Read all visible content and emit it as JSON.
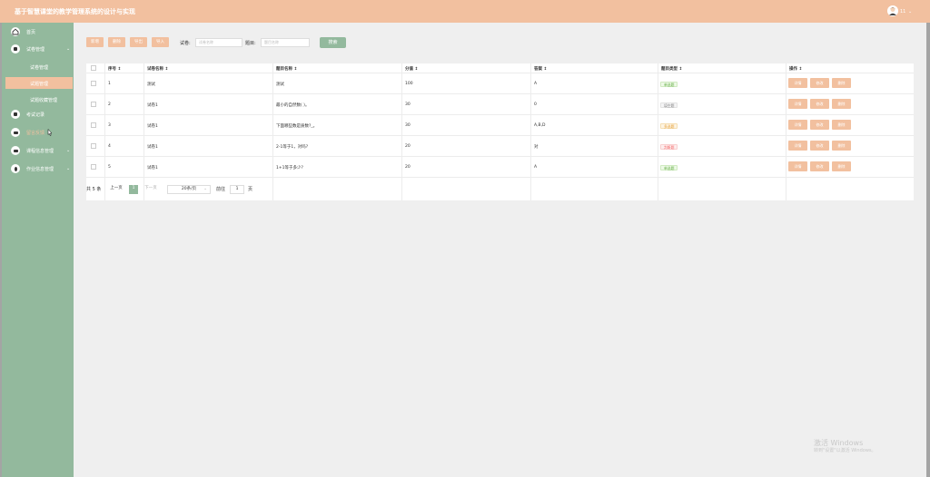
{
  "header": {
    "title": "基于智慧课堂的教学管理系统的设计与实现",
    "user": "11",
    "user_arrow": "⌄"
  },
  "sidebar": {
    "items": [
      {
        "label": "首页",
        "icon": "home-icon"
      },
      {
        "label": "试卷管理",
        "icon": "paper-icon",
        "chevron": "⌄"
      },
      {
        "label": "考试记录",
        "icon": "record-icon"
      },
      {
        "label": "留言反馈",
        "icon": "message-icon"
      },
      {
        "label": "课程信息管理",
        "icon": "course-icon",
        "chevron": "⌄"
      },
      {
        "label": "作业信息管理",
        "icon": "homework-icon",
        "chevron": "⌄"
      }
    ],
    "sub_items": [
      {
        "label": "试卷管理"
      },
      {
        "label": "试题管理",
        "active": true
      },
      {
        "label": "试题收藏管理"
      }
    ]
  },
  "toolbar": {
    "add": "新增",
    "delete": "删除",
    "export": "导出",
    "import": "导入",
    "exam_label": "试卷:",
    "exam_placeholder": "试卷名称",
    "question_label": "题目:",
    "question_placeholder": "题目名称",
    "search": "搜索"
  },
  "table": {
    "headers": {
      "index": "序号 ↕",
      "paper": "试卷名称 ↕",
      "question": "题目名称 ↕",
      "score": "分值 ↕",
      "answer": "答案 ↕",
      "type": "题目类型 ↕",
      "actions": "操作 ↕"
    },
    "rows": [
      {
        "index": "1",
        "paper": "测试",
        "question": "测试",
        "score": "100",
        "answer": "A",
        "type": "单选题"
      },
      {
        "index": "2",
        "paper": "试卷1",
        "question": "最小的自然数( )。",
        "score": "30",
        "answer": "0",
        "type": "填空题"
      },
      {
        "index": "3",
        "paper": "试卷1",
        "question": "下面哪些数是质数?_。",
        "score": "30",
        "answer": "A,B,D",
        "type": "多选题"
      },
      {
        "index": "4",
        "paper": "试卷1",
        "question": "2-1等于1，对吗?",
        "score": "20",
        "answer": "对",
        "type": "判断题"
      },
      {
        "index": "5",
        "paper": "试卷1",
        "question": "1+1等于多少?",
        "score": "20",
        "answer": "A",
        "type": "单选题"
      }
    ],
    "op_detail": "详情",
    "op_edit": "修改",
    "op_delete": "删除"
  },
  "pager": {
    "total": "共 5 条",
    "prev": "上一页",
    "page": "1",
    "next": "下一页",
    "size": "20条/页",
    "size_arrow": "⌄",
    "goto": "前往",
    "goto_value": "1",
    "unit": "页"
  },
  "watermark": {
    "line1": "激活 Windows",
    "line2": "转到\"设置\"以激活 Windows。"
  },
  "colors": {
    "accent": "#f2c09f",
    "sidebar": "#93b99d",
    "content_bg": "#efefef"
  }
}
